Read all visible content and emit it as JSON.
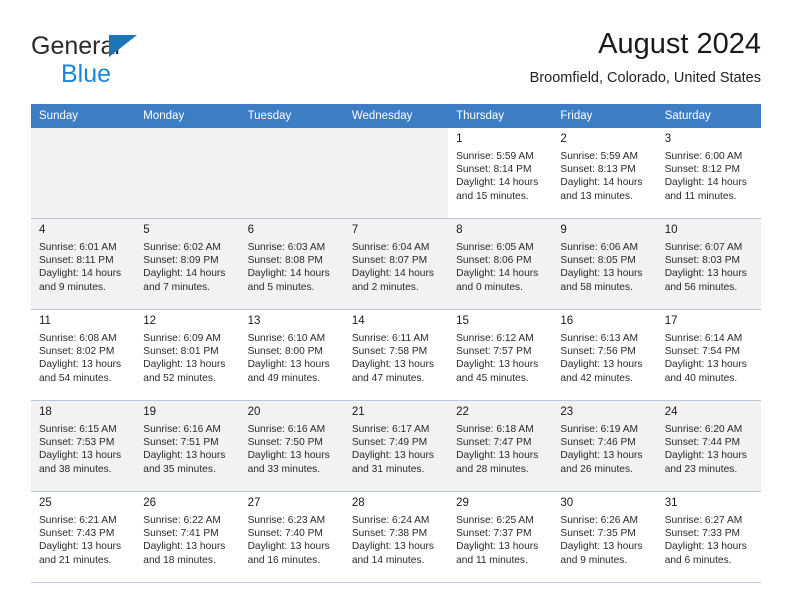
{
  "brand": {
    "line1": "General",
    "line2": "Blue",
    "triangle_color": "#1b75bb",
    "line2_color": "#1b87d8"
  },
  "header": {
    "title": "August 2024",
    "subtitle": "Broomfield, Colorado, United States",
    "header_bg": "#3c7dc4",
    "header_text_color": "#ffffff"
  },
  "weekday_headers": [
    "Sunday",
    "Monday",
    "Tuesday",
    "Wednesday",
    "Thursday",
    "Friday",
    "Saturday"
  ],
  "weeks": [
    {
      "shaded": false,
      "days": [
        {
          "blank": true
        },
        {
          "blank": true
        },
        {
          "blank": true
        },
        {
          "blank": true
        },
        {
          "blank": false,
          "day": "1",
          "sunrise": "Sunrise: 5:59 AM",
          "sunset": "Sunset: 8:14 PM",
          "daylight": "Daylight: 14 hours and 15 minutes."
        },
        {
          "blank": false,
          "day": "2",
          "sunrise": "Sunrise: 5:59 AM",
          "sunset": "Sunset: 8:13 PM",
          "daylight": "Daylight: 14 hours and 13 minutes."
        },
        {
          "blank": false,
          "day": "3",
          "sunrise": "Sunrise: 6:00 AM",
          "sunset": "Sunset: 8:12 PM",
          "daylight": "Daylight: 14 hours and 11 minutes."
        }
      ]
    },
    {
      "shaded": true,
      "days": [
        {
          "blank": false,
          "day": "4",
          "sunrise": "Sunrise: 6:01 AM",
          "sunset": "Sunset: 8:11 PM",
          "daylight": "Daylight: 14 hours and 9 minutes."
        },
        {
          "blank": false,
          "day": "5",
          "sunrise": "Sunrise: 6:02 AM",
          "sunset": "Sunset: 8:09 PM",
          "daylight": "Daylight: 14 hours and 7 minutes."
        },
        {
          "blank": false,
          "day": "6",
          "sunrise": "Sunrise: 6:03 AM",
          "sunset": "Sunset: 8:08 PM",
          "daylight": "Daylight: 14 hours and 5 minutes."
        },
        {
          "blank": false,
          "day": "7",
          "sunrise": "Sunrise: 6:04 AM",
          "sunset": "Sunset: 8:07 PM",
          "daylight": "Daylight: 14 hours and 2 minutes."
        },
        {
          "blank": false,
          "day": "8",
          "sunrise": "Sunrise: 6:05 AM",
          "sunset": "Sunset: 8:06 PM",
          "daylight": "Daylight: 14 hours and 0 minutes."
        },
        {
          "blank": false,
          "day": "9",
          "sunrise": "Sunrise: 6:06 AM",
          "sunset": "Sunset: 8:05 PM",
          "daylight": "Daylight: 13 hours and 58 minutes."
        },
        {
          "blank": false,
          "day": "10",
          "sunrise": "Sunrise: 6:07 AM",
          "sunset": "Sunset: 8:03 PM",
          "daylight": "Daylight: 13 hours and 56 minutes."
        }
      ]
    },
    {
      "shaded": false,
      "days": [
        {
          "blank": false,
          "day": "11",
          "sunrise": "Sunrise: 6:08 AM",
          "sunset": "Sunset: 8:02 PM",
          "daylight": "Daylight: 13 hours and 54 minutes."
        },
        {
          "blank": false,
          "day": "12",
          "sunrise": "Sunrise: 6:09 AM",
          "sunset": "Sunset: 8:01 PM",
          "daylight": "Daylight: 13 hours and 52 minutes."
        },
        {
          "blank": false,
          "day": "13",
          "sunrise": "Sunrise: 6:10 AM",
          "sunset": "Sunset: 8:00 PM",
          "daylight": "Daylight: 13 hours and 49 minutes."
        },
        {
          "blank": false,
          "day": "14",
          "sunrise": "Sunrise: 6:11 AM",
          "sunset": "Sunset: 7:58 PM",
          "daylight": "Daylight: 13 hours and 47 minutes."
        },
        {
          "blank": false,
          "day": "15",
          "sunrise": "Sunrise: 6:12 AM",
          "sunset": "Sunset: 7:57 PM",
          "daylight": "Daylight: 13 hours and 45 minutes."
        },
        {
          "blank": false,
          "day": "16",
          "sunrise": "Sunrise: 6:13 AM",
          "sunset": "Sunset: 7:56 PM",
          "daylight": "Daylight: 13 hours and 42 minutes."
        },
        {
          "blank": false,
          "day": "17",
          "sunrise": "Sunrise: 6:14 AM",
          "sunset": "Sunset: 7:54 PM",
          "daylight": "Daylight: 13 hours and 40 minutes."
        }
      ]
    },
    {
      "shaded": true,
      "days": [
        {
          "blank": false,
          "day": "18",
          "sunrise": "Sunrise: 6:15 AM",
          "sunset": "Sunset: 7:53 PM",
          "daylight": "Daylight: 13 hours and 38 minutes."
        },
        {
          "blank": false,
          "day": "19",
          "sunrise": "Sunrise: 6:16 AM",
          "sunset": "Sunset: 7:51 PM",
          "daylight": "Daylight: 13 hours and 35 minutes."
        },
        {
          "blank": false,
          "day": "20",
          "sunrise": "Sunrise: 6:16 AM",
          "sunset": "Sunset: 7:50 PM",
          "daylight": "Daylight: 13 hours and 33 minutes."
        },
        {
          "blank": false,
          "day": "21",
          "sunrise": "Sunrise: 6:17 AM",
          "sunset": "Sunset: 7:49 PM",
          "daylight": "Daylight: 13 hours and 31 minutes."
        },
        {
          "blank": false,
          "day": "22",
          "sunrise": "Sunrise: 6:18 AM",
          "sunset": "Sunset: 7:47 PM",
          "daylight": "Daylight: 13 hours and 28 minutes."
        },
        {
          "blank": false,
          "day": "23",
          "sunrise": "Sunrise: 6:19 AM",
          "sunset": "Sunset: 7:46 PM",
          "daylight": "Daylight: 13 hours and 26 minutes."
        },
        {
          "blank": false,
          "day": "24",
          "sunrise": "Sunrise: 6:20 AM",
          "sunset": "Sunset: 7:44 PM",
          "daylight": "Daylight: 13 hours and 23 minutes."
        }
      ]
    },
    {
      "shaded": false,
      "days": [
        {
          "blank": false,
          "day": "25",
          "sunrise": "Sunrise: 6:21 AM",
          "sunset": "Sunset: 7:43 PM",
          "daylight": "Daylight: 13 hours and 21 minutes."
        },
        {
          "blank": false,
          "day": "26",
          "sunrise": "Sunrise: 6:22 AM",
          "sunset": "Sunset: 7:41 PM",
          "daylight": "Daylight: 13 hours and 18 minutes."
        },
        {
          "blank": false,
          "day": "27",
          "sunrise": "Sunrise: 6:23 AM",
          "sunset": "Sunset: 7:40 PM",
          "daylight": "Daylight: 13 hours and 16 minutes."
        },
        {
          "blank": false,
          "day": "28",
          "sunrise": "Sunrise: 6:24 AM",
          "sunset": "Sunset: 7:38 PM",
          "daylight": "Daylight: 13 hours and 14 minutes."
        },
        {
          "blank": false,
          "day": "29",
          "sunrise": "Sunrise: 6:25 AM",
          "sunset": "Sunset: 7:37 PM",
          "daylight": "Daylight: 13 hours and 11 minutes."
        },
        {
          "blank": false,
          "day": "30",
          "sunrise": "Sunrise: 6:26 AM",
          "sunset": "Sunset: 7:35 PM",
          "daylight": "Daylight: 13 hours and 9 minutes."
        },
        {
          "blank": false,
          "day": "31",
          "sunrise": "Sunrise: 6:27 AM",
          "sunset": "Sunset: 7:33 PM",
          "daylight": "Daylight: 13 hours and 6 minutes."
        }
      ]
    }
  ]
}
